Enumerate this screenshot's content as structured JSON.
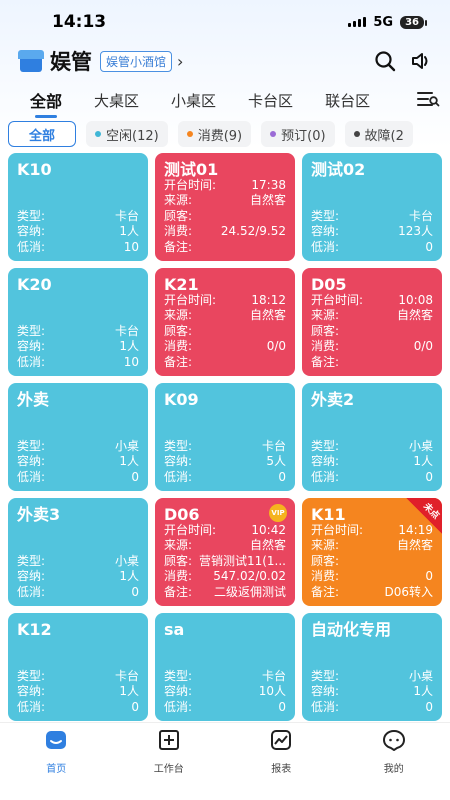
{
  "status_bar": {
    "time": "14:13",
    "network": "5G",
    "battery": "36"
  },
  "header": {
    "app_title": "娱管",
    "store_name": "娱管小酒馆",
    "chevron": "›",
    "icons": [
      "search-icon",
      "speaker-icon"
    ]
  },
  "tabs": [
    {
      "label": "全部",
      "active": true
    },
    {
      "label": "大桌区",
      "active": false
    },
    {
      "label": "小桌区",
      "active": false
    },
    {
      "label": "卡台区",
      "active": false
    },
    {
      "label": "联台区",
      "active": false
    }
  ],
  "chips": [
    {
      "label": "全部",
      "active": true,
      "color": ""
    },
    {
      "label": "空闲(12)",
      "active": false,
      "color": "#3fb6d6"
    },
    {
      "label": "消费(9)",
      "active": false,
      "color": "#f5851f"
    },
    {
      "label": "预订(0)",
      "active": false,
      "color": "#9b6bd6"
    },
    {
      "label": "故障(2",
      "active": false,
      "color": "#444444"
    }
  ],
  "cards": [
    {
      "title": "K10",
      "color": "blue",
      "rows": [
        [
          "类型:",
          "卡台"
        ],
        [
          "容纳:",
          "1人"
        ],
        [
          "低消:",
          "10"
        ]
      ]
    },
    {
      "title": "测试01",
      "color": "red",
      "rows": [
        [
          "开台时间:",
          "17:38"
        ],
        [
          "来源:",
          "自然客"
        ],
        [
          "顾客:",
          ""
        ],
        [
          "消费:",
          "24.52/9.52"
        ],
        [
          "备注:",
          ""
        ]
      ]
    },
    {
      "title": "测试02",
      "color": "blue",
      "rows": [
        [
          "类型:",
          "卡台"
        ],
        [
          "容纳:",
          "123人"
        ],
        [
          "低消:",
          "0"
        ]
      ]
    },
    {
      "title": "K20",
      "color": "blue",
      "rows": [
        [
          "类型:",
          "卡台"
        ],
        [
          "容纳:",
          "1人"
        ],
        [
          "低消:",
          "10"
        ]
      ]
    },
    {
      "title": "K21",
      "color": "red",
      "rows": [
        [
          "开台时间:",
          "18:12"
        ],
        [
          "来源:",
          "自然客"
        ],
        [
          "顾客:",
          ""
        ],
        [
          "消费:",
          "0/0"
        ],
        [
          "备注:",
          ""
        ]
      ]
    },
    {
      "title": "D05",
      "color": "red",
      "rows": [
        [
          "开台时间:",
          "10:08"
        ],
        [
          "来源:",
          "自然客"
        ],
        [
          "顾客:",
          ""
        ],
        [
          "消费:",
          "0/0"
        ],
        [
          "备注:",
          ""
        ]
      ]
    },
    {
      "title": "外卖",
      "color": "blue",
      "rows": [
        [
          "类型:",
          "小桌"
        ],
        [
          "容纳:",
          "1人"
        ],
        [
          "低消:",
          "0"
        ]
      ]
    },
    {
      "title": "K09",
      "color": "blue",
      "rows": [
        [
          "类型:",
          "卡台"
        ],
        [
          "容纳:",
          "5人"
        ],
        [
          "低消:",
          "0"
        ]
      ]
    },
    {
      "title": "外卖2",
      "color": "blue",
      "rows": [
        [
          "类型:",
          "小桌"
        ],
        [
          "容纳:",
          "1人"
        ],
        [
          "低消:",
          "0"
        ]
      ]
    },
    {
      "title": "外卖3",
      "color": "blue",
      "rows": [
        [
          "类型:",
          "小桌"
        ],
        [
          "容纳:",
          "1人"
        ],
        [
          "低消:",
          "0"
        ]
      ]
    },
    {
      "title": "D06",
      "color": "red",
      "badge": "VIP",
      "rows": [
        [
          "开台时间:",
          "10:42"
        ],
        [
          "来源:",
          "自然客"
        ],
        [
          "顾客:",
          "营销测试11(1..."
        ],
        [
          "消费:",
          "547.02/0.02"
        ],
        [
          "备注:",
          "二级返佣测试"
        ]
      ]
    },
    {
      "title": "K11",
      "color": "orange",
      "corner": "未点",
      "rows": [
        [
          "开台时间:",
          "14:19"
        ],
        [
          "来源:",
          "自然客"
        ],
        [
          "顾客:",
          ""
        ],
        [
          "消费:",
          "0"
        ],
        [
          "备注:",
          "D06转入"
        ]
      ]
    },
    {
      "title": "K12",
      "color": "blue",
      "rows": [
        [
          "类型:",
          "卡台"
        ],
        [
          "容纳:",
          "1人"
        ],
        [
          "低消:",
          "0"
        ]
      ]
    },
    {
      "title": "sa",
      "color": "blue",
      "rows": [
        [
          "类型:",
          "卡台"
        ],
        [
          "容纳:",
          "10人"
        ],
        [
          "低消:",
          "0"
        ]
      ]
    },
    {
      "title": "自动化专用",
      "color": "blue",
      "rows": [
        [
          "类型:",
          "小桌"
        ],
        [
          "容纳:",
          "1人"
        ],
        [
          "低消:",
          "0"
        ]
      ]
    }
  ],
  "bottom_nav": [
    {
      "label": "首页",
      "icon": "home-icon",
      "active": true
    },
    {
      "label": "工作台",
      "icon": "workbench-icon",
      "active": false
    },
    {
      "label": "报表",
      "icon": "report-icon",
      "active": false
    },
    {
      "label": "我的",
      "icon": "profile-icon",
      "active": false
    }
  ],
  "colors": {
    "accent": "#2f7fe0",
    "idle": "#52c4dd",
    "consuming": "#e9465f",
    "pending": "#f5851f"
  }
}
